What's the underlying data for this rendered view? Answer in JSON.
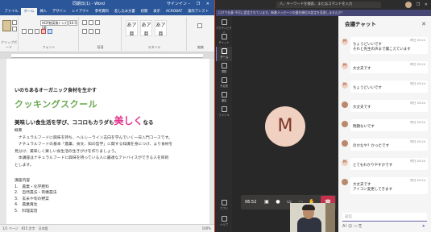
{
  "word": {
    "title": "同期日(1) - Word",
    "user": "サインイン",
    "window_controls": "– ❐ ✕",
    "tabs": [
      "ファイル",
      "ホーム",
      "挿入",
      "デザイン",
      "レイアウト",
      "参考資料",
      "差し込み文書",
      "校閲",
      "表示",
      "ACROBAT",
      "操作アシスト"
    ],
    "active_tab_index": 1,
    "font_name": "HGP創英角ｺﾞｼｯｸUB",
    "font_size": "10.5",
    "group_labels": {
      "clipboard": "クリップボード",
      "font": "フォント",
      "paragraph": "段落",
      "styles": "スタイル",
      "editing": "編集"
    },
    "style_samples": [
      "あア亜",
      "あア亜",
      "あア亜"
    ],
    "doc": {
      "line1": "いのちあるオーガニック食材を生かす",
      "title": "クッキングスクール",
      "line3_before": "美味しい食生活を学び、ココロもカラダも",
      "line3_emph": "美しく",
      "line3_after": "なる",
      "body": [
        "概要",
        "　ナチュラルフードに興味を持ち、ヘルシーライン志向を学んでいく一日入門コースです。",
        "　ナチュラルフードの基本「農業、食文、知の哲学」に関する知識を身につけ、より食材を",
        "見分け、美味しく楽しい食生活の生きがけを作りましょう。",
        "　本講座はナチュラルフードに興味を持っている人に最適なアドバイスができる人を目的",
        "とします。"
      ],
      "list_heading": "講座内容",
      "list": [
        "1.　農業・化学肥料",
        "2.　自然農法・有機農法",
        "3.　玄米や旬の野菜",
        "4.　農業再生",
        "5.　料理実習"
      ]
    },
    "status": "1/1 ページ　815 文字　日本語",
    "zoom": "100%"
  },
  "teams": {
    "search_placeholder": "人、キーワードを検索、またはコマンドを入力",
    "window_controls": "– ❐ ✕",
    "banner": "ログで仕事 不可に設定されています。新着メッセージの優先順位の設定を見直しませんか？",
    "rail": [
      {
        "label": "アクティビティ",
        "active": false
      },
      {
        "label": "チャット",
        "active": false
      },
      {
        "label": "チーム",
        "active": true
      },
      {
        "label": "課題",
        "active": false
      },
      {
        "label": "予定表",
        "active": false
      },
      {
        "label": "通話",
        "active": false
      },
      {
        "label": "ファイル",
        "active": false
      },
      {
        "label": "アプリ",
        "active": false
      },
      {
        "label": "ヘルプ",
        "active": false
      }
    ],
    "meeting": {
      "avatar_initial": "M",
      "timer": "06:52"
    },
    "chat": {
      "title": "会議チャット",
      "close": "✕",
      "messages": [
        {
          "initial": "M",
          "time": "昨日 03:23",
          "text": "ちょうどいいです\nそれと先生の声まで聞こえています"
        },
        {
          "initial": "M",
          "time": "昨日 03:24",
          "text": "大丈夫です"
        },
        {
          "initial": "M",
          "time": "昨日 03:24",
          "text": "ちょうどいいです"
        },
        {
          "initial": "",
          "time": "昨日 03:24",
          "text": "大丈夫です"
        },
        {
          "initial": "",
          "time": "昨日 03:24",
          "text": "問題ないです"
        },
        {
          "initial": "",
          "time": "昨日 03:24",
          "text": "のかなや？かったです"
        },
        {
          "initial": "M",
          "time": "昨日 03:24",
          "text": "とてもわかりやすかです"
        },
        {
          "initial": "",
          "time": "昨日 03:24",
          "text": "大丈夫です\nアイコン変更してきます"
        }
      ],
      "compose_placeholder": "返信",
      "compose_tools": "A!  ☺  ▭  ⎘",
      "send_icon": "➤"
    }
  }
}
